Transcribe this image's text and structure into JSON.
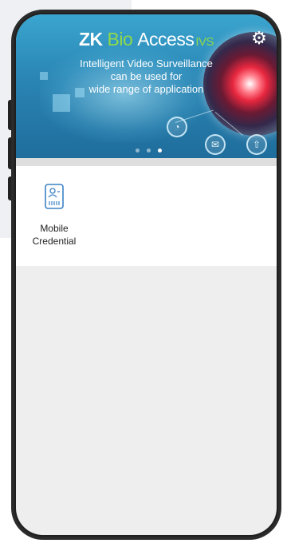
{
  "banner": {
    "brand_zk": "ZK",
    "brand_bio": "Bio",
    "brand_access": "Access",
    "brand_ivs": "IVS",
    "tagline_line1": "Intelligent Video Surveillance",
    "tagline_line2": "can be used for",
    "tagline_line3": "wide range of application",
    "active_slide": 3,
    "slide_count": 3
  },
  "icons": {
    "settings": "gear-icon",
    "tile": "mobile-credential-icon"
  },
  "tiles": [
    {
      "label_line1": "Mobile",
      "label_line2": "Credential"
    }
  ],
  "colors": {
    "banner_blue": "#2a85b4",
    "brand_green": "#8fd94a",
    "tile_icon_blue": "#3b82c4",
    "screen_bg": "#eeeeee"
  }
}
